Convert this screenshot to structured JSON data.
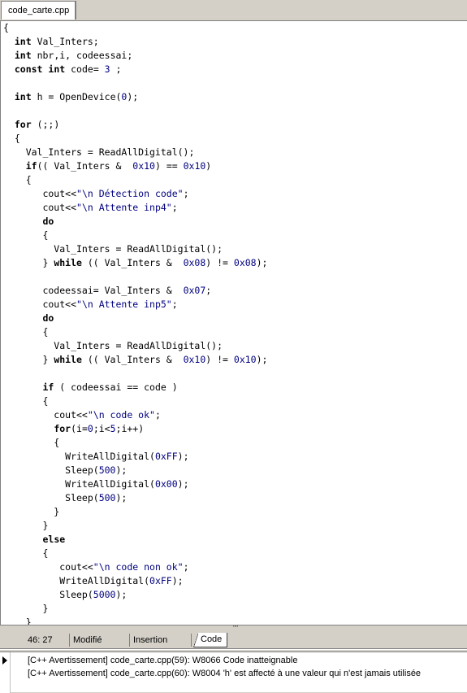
{
  "tab": {
    "title": "code_carte.cpp"
  },
  "code_lines": [
    "{",
    "  int Val_Inters;",
    "  int nbr,i, codeessai;",
    "  const int code= 3 ;",
    "",
    "  int h = OpenDevice(0);",
    "",
    "  for (;;)",
    "  {",
    "    Val_Inters = ReadAllDigital();",
    "    if(( Val_Inters &  0x10) == 0x10)",
    "    {",
    "       cout<<\"\\n Détection code\";",
    "       cout<<\"\\n Attente inp4\";",
    "       do",
    "       {",
    "         Val_Inters = ReadAllDigital();",
    "       } while (( Val_Inters &  0x08) != 0x08);",
    "",
    "       codeessai= Val_Inters &  0x07;",
    "       cout<<\"\\n Attente inp5\";",
    "       do",
    "       {",
    "         Val_Inters = ReadAllDigital();",
    "       } while (( Val_Inters &  0x10) != 0x10);",
    "",
    "       if ( codeessai == code )",
    "       {",
    "         cout<<\"\\n code ok\";",
    "         for(i=0;i<5;i++)",
    "         {",
    "           WriteAllDigital(0xFF);",
    "           Sleep(500);",
    "           WriteAllDigital(0x00);",
    "           Sleep(500);",
    "         }",
    "       }",
    "       else",
    "       {",
    "          cout<<\"\\n code non ok\";",
    "          WriteAllDigital(0xFF);",
    "          Sleep(5000);",
    "       }",
    "    }"
  ],
  "hscroll": {
    "grip": "''''"
  },
  "status": {
    "position": "46:  27",
    "modified": "Modifié",
    "mode": "Insertion",
    "view_tab": "Code"
  },
  "messages": [
    "[C++ Avertissement] code_carte.cpp(59): W8066 Code inatteignable",
    "[C++ Avertissement] code_carte.cpp(60): W8004 'h' est affecté à une valeur qui n'est jamais utilisée"
  ]
}
